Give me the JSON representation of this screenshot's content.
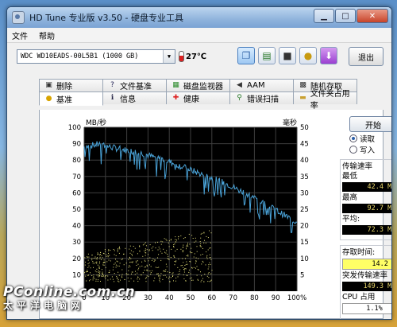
{
  "window": {
    "title": "HD Tune 专业版 v3.50 - 硬盘专业工具"
  },
  "menu": [
    "文件",
    "帮助"
  ],
  "toolbar": {
    "drive": "WDC WD10EADS-00L5B1 (1000 GB)",
    "temperature": "27℃",
    "exit_label": "退出"
  },
  "tabs_top": [
    "删除",
    "文件基准",
    "磁盘监视器",
    "AAM",
    "随机存取"
  ],
  "tabs_bottom": [
    "基准",
    "信息",
    "健康",
    "错误扫描",
    "文件夹占用率"
  ],
  "side": {
    "start_label": "开始",
    "read_label": "读取",
    "write_label": "写入",
    "transfer_title": "传输速率",
    "min_label": "最低",
    "min_value": "42.4 MB/秒",
    "max_label": "最高",
    "max_value": "92.7 MB/秒",
    "avg_label": "平均:",
    "avg_value": "72.3 MB/秒",
    "access_label": "存取时间:",
    "access_value": "14.2 毫秒",
    "burst_label": "突发传输速率",
    "burst_value": "149.3 MB/秒",
    "cpu_label": "CPU 占用",
    "cpu_value": "1.1%"
  },
  "chart_data": {
    "type": "line",
    "y_left_unit": "MB/秒",
    "y_right_unit": "毫秒",
    "ylim_left": [
      0,
      100
    ],
    "ylim_right": [
      0,
      50
    ],
    "y_left_ticks": [
      10,
      20,
      30,
      40,
      50,
      60,
      70,
      80,
      90,
      100
    ],
    "y_right_ticks": [
      5,
      10,
      15,
      20,
      25,
      30,
      35,
      40,
      45,
      50
    ],
    "x_ticks": [
      "0",
      "10",
      "20",
      "30",
      "40",
      "50",
      "60",
      "70",
      "80",
      "90",
      "100%"
    ],
    "xlim": [
      0,
      100
    ],
    "grid": true,
    "series": [
      {
        "color": "#4aa3d8",
        "x": [
          0,
          4,
          8,
          12,
          16,
          20,
          24,
          28,
          32,
          36,
          40,
          44,
          48,
          52,
          56,
          60,
          64,
          68,
          72,
          76,
          80,
          84,
          88,
          92,
          96,
          100
        ],
        "y": [
          88,
          89,
          90,
          88,
          87,
          86,
          85,
          84,
          82,
          81,
          79,
          77,
          75,
          73,
          71,
          69,
          67,
          65,
          62,
          60,
          57,
          54,
          51,
          48,
          45,
          42
        ]
      }
    ],
    "access_scatter": {
      "color": "#e6e27a",
      "x_range": [
        0,
        60
      ],
      "y_range_ms": [
        3,
        19
      ]
    }
  },
  "watermark": {
    "line1": "PConline.com.cn",
    "line2": "太平洋电脑网"
  }
}
